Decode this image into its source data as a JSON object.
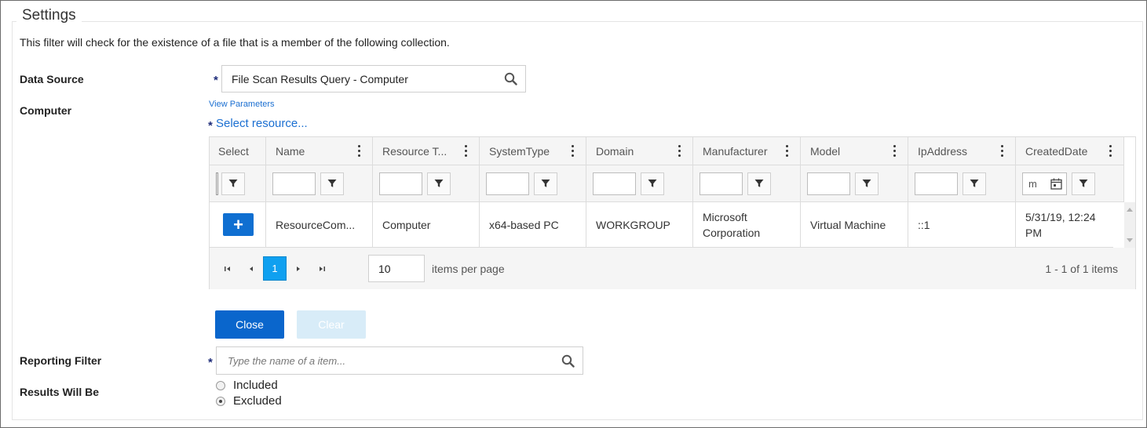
{
  "section": {
    "legend": "Settings",
    "description": "This filter will check for the existence of a file that is a member of the following collection."
  },
  "data_source": {
    "label": "Data Source",
    "required_mark": "*",
    "value": "File Scan Results Query - Computer"
  },
  "computer": {
    "label": "Computer",
    "view_parameters": "View Parameters",
    "required_mark": "*",
    "select_resource": "Select resource..."
  },
  "grid": {
    "columns": [
      "Select",
      "Name",
      "Resource T...",
      "SystemType",
      "Domain",
      "Manufacturer",
      "Model",
      "IpAddress",
      "CreatedDate"
    ],
    "date_filter_text": "m",
    "rows": [
      {
        "name": "ResourceCom...",
        "resource_type": "Computer",
        "system_type": "x64-based PC",
        "domain": "WORKGROUP",
        "manufacturer": "Microsoft Corporation",
        "model": "Virtual Machine",
        "ip_address": "::1",
        "created_date": "5/31/19, 12:24 PM"
      }
    ],
    "pager": {
      "current_page": "1",
      "page_size": "10",
      "items_per_page_label": "items per page",
      "info": "1 - 1 of 1 items"
    }
  },
  "buttons": {
    "close": "Close",
    "clear": "Clear"
  },
  "reporting_filter": {
    "label": "Reporting Filter",
    "required_mark": "*",
    "placeholder": "Type the name of a item..."
  },
  "results": {
    "label": "Results Will Be",
    "options": [
      "Included",
      "Excluded"
    ],
    "selected": "Excluded"
  },
  "colors": {
    "primary": "#0a66cc",
    "link": "#1b6fd1",
    "page_active": "#0fa0f0",
    "required": "#1f2d7a"
  }
}
